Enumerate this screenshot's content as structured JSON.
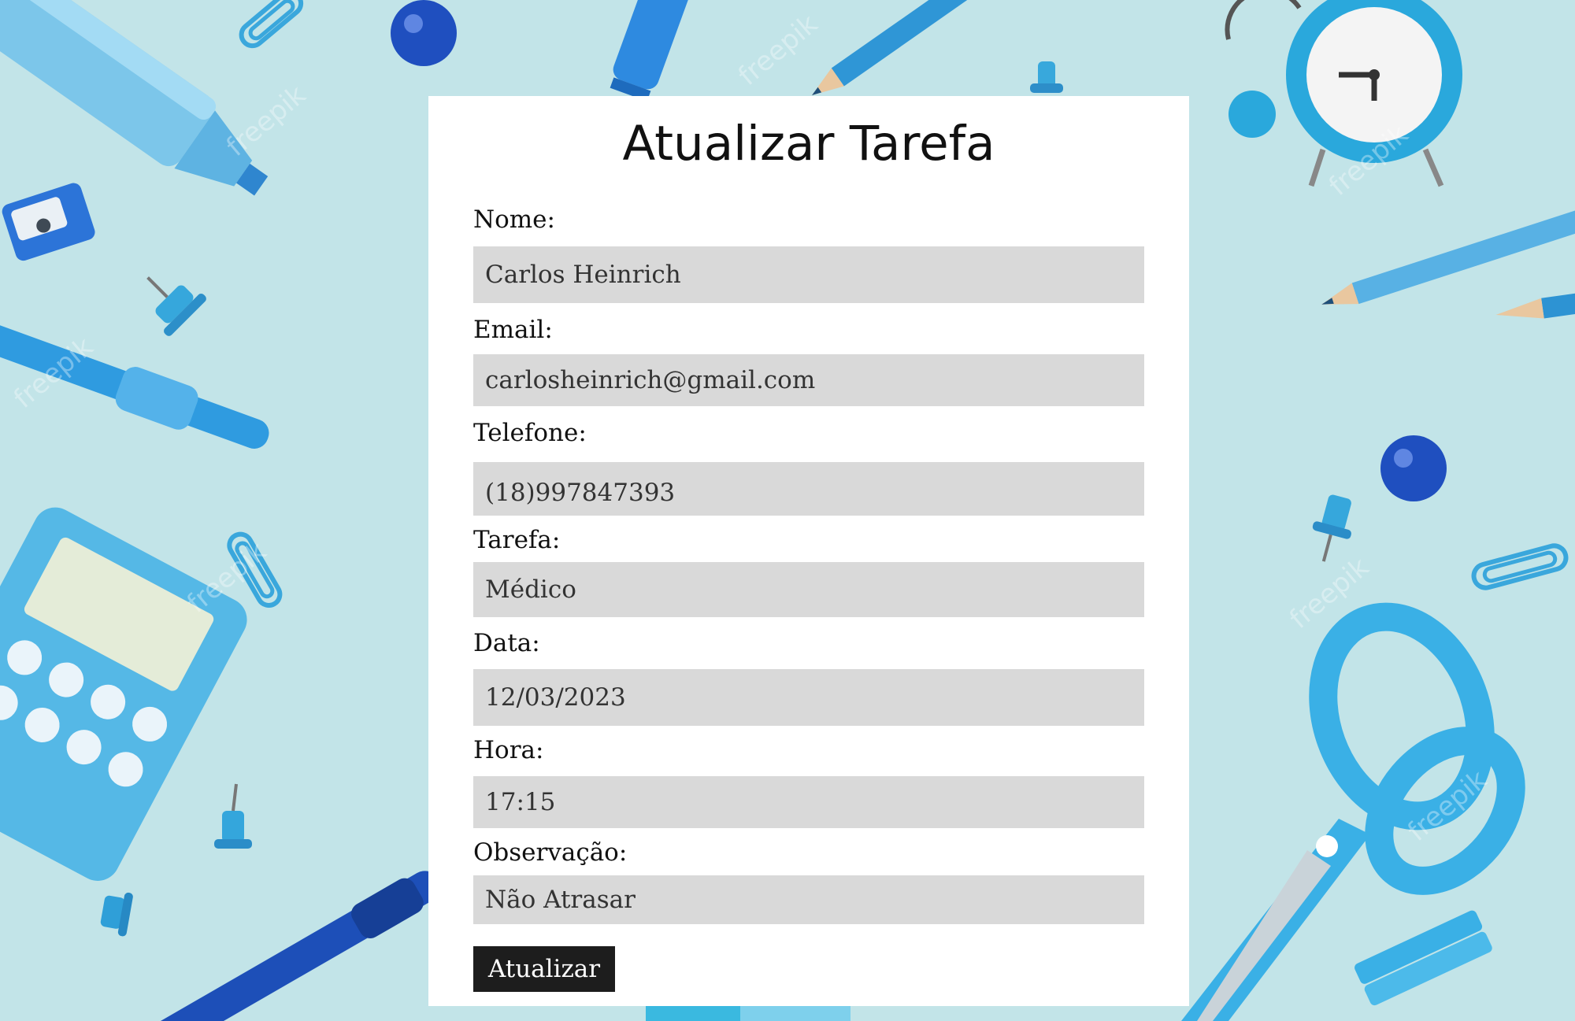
{
  "form": {
    "title": "Atualizar Tarefa",
    "fields": [
      {
        "label": "Nome:",
        "value": "Carlos Heinrich"
      },
      {
        "label": "Email:",
        "value": "carlosheinrich@gmail.com"
      },
      {
        "label": "Telefone:",
        "value": "(18)997847393"
      },
      {
        "label": "Tarefa:",
        "value": "Médico"
      },
      {
        "label": "Data:",
        "value": "12/03/2023"
      },
      {
        "label": "Hora:",
        "value": "17:15"
      },
      {
        "label": "Observação:",
        "value": "Não Atrasar"
      }
    ],
    "submit_label": "Atualizar"
  },
  "background": {
    "watermark": "freepik",
    "colors": {
      "background": "#c2e4e8",
      "light_blue": "#3bb4e0",
      "deep_blue": "#1a5fc7",
      "card": "#ffffff",
      "input": "#d9d9d9",
      "button": "#1d1d1d"
    }
  }
}
